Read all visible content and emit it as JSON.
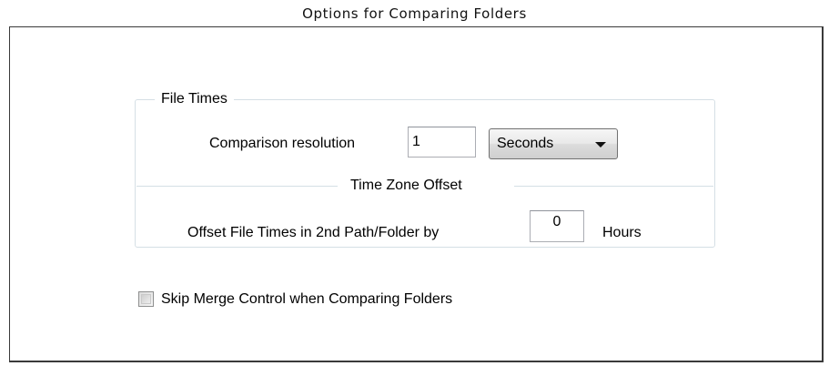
{
  "caption": "Options for Comparing Folders",
  "file_times": {
    "group_label": "File Times",
    "resolution_label": "Comparison resolution",
    "resolution_value": "1",
    "resolution_unit": "Seconds",
    "tz_section_label": "Time Zone Offset",
    "offset_label": "Offset File Times in 2nd Path/Folder by",
    "offset_value": "0",
    "offset_unit": "Hours"
  },
  "skip_merge": {
    "label": "Skip Merge Control when Comparing Folders",
    "checked": false
  }
}
